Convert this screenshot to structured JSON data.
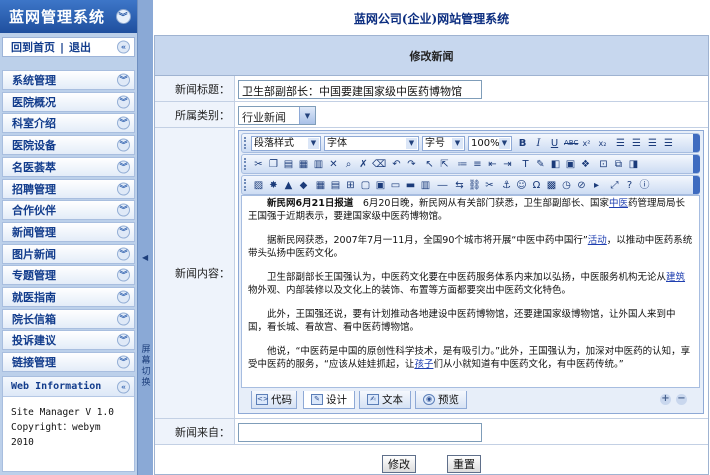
{
  "sidebar": {
    "title": "蓝网管理系统",
    "collapse_glyph": "«",
    "home": "回到首页",
    "separator": "|",
    "logout": "退出",
    "items": [
      {
        "label": "系统管理"
      },
      {
        "label": "医院概况"
      },
      {
        "label": "科室介绍"
      },
      {
        "label": "医院设备"
      },
      {
        "label": "名医荟萃"
      },
      {
        "label": "招聘管理"
      },
      {
        "label": "合作伙伴"
      },
      {
        "label": "新闻管理"
      },
      {
        "label": "图片新闻"
      },
      {
        "label": "专题管理"
      },
      {
        "label": "就医指南"
      },
      {
        "label": "院长信箱"
      },
      {
        "label": "投诉建议"
      },
      {
        "label": "链接管理"
      }
    ],
    "info": {
      "heading": "Web Information",
      "line1": "Site Manager V 1.0",
      "line2": "Copyright：webym",
      "line3": "2010"
    }
  },
  "strip": {
    "label": "屏幕切换"
  },
  "main": {
    "site_title": "蓝网公司(企业)网站管理系统",
    "panel_title": "修改新闻",
    "fields": {
      "title_label": "新闻标题：",
      "title_value": "卫生部副部长：中国要建国家级中医药博物馆",
      "category_label": "所属类别：",
      "category_value": "行业新闻",
      "content_label": "新闻内容：",
      "source_label": "新闻来自：",
      "source_value": ""
    },
    "editor": {
      "paragraph_style": "段落样式",
      "font": "字体",
      "font_size": "字号",
      "zoom": "100%",
      "modes": {
        "code": "代码",
        "design": "设计",
        "text": "文本",
        "preview": "预览"
      },
      "paragraphs": [
        {
          "lead": "新民网6月21日报道",
          "text": "　6月20日晚，新民网从有关部门获悉，卫生部副部长、国家",
          "link": "中医",
          "tail": "药管理局局长王国强于近期表示，要建国家级中医药博物馆。"
        },
        {
          "text": "据新民网获悉，2007年7月一11月，全国90个城市将开展“中医中药中国行”",
          "link": "活动",
          "tail": "，以推动中医药系统带头弘扬中医药文化。"
        },
        {
          "text": "卫生部副部长王国强认为，中医药文化要在中医药服务体系内来加以弘扬，中医服务机构无论从",
          "link": "建筑",
          "tail": "物外观、内部装修以及文化上的装饰、布置等方面都要突出中医药文化特色。"
        },
        {
          "text": "此外，王国强还说，要有计划推动各地建设中医药博物馆，还要建国家级博物馆，让外国人来到中国，看长城、看故宫、看中医药博物馆。"
        },
        {
          "text": "他说，“中医药是中国的原创性科学技术，是有吸引力。”此外，王国强认为，加深对中医药的认知，享受中医药的服务，“应该从娃娃抓起，让",
          "link": "孩子",
          "tail": "们从小就知道有中医药文化，有中医药传统。”"
        }
      ]
    },
    "buttons": {
      "submit": "修改",
      "reset": "重置"
    }
  }
}
